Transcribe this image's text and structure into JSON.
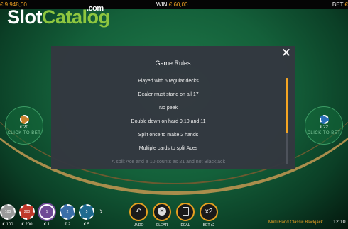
{
  "topbar": {
    "balance": "€ 9.948,00",
    "win_label": "WIN",
    "win_value": "€ 60,00",
    "bet_label": "BET",
    "bet_value": "€"
  },
  "logo": {
    "slot": "Slot",
    "catalog": "Catalog",
    "dotcom": ".com"
  },
  "bet_spots": [
    {
      "amount": "€ 20",
      "click_text": "CLICK TO BET",
      "chip_color": "#c9822c"
    },
    {
      "amount": "€ 22",
      "click_text": "CLICK TO BET",
      "chip_color": "#2a6fb8"
    }
  ],
  "modal": {
    "title": "Game Rules",
    "close_icon": "close-icon",
    "rules": [
      "Played with 6 regular decks",
      "Dealer must stand on all 17",
      "No peek",
      "Double down on hard 9,10 and 11",
      "Split once to make 2 hands",
      "Multiple cards to split Aces",
      "A split Ace and a 10 counts as 21 and not Blackjack"
    ],
    "scroll_fraction": 0.64
  },
  "chips": [
    {
      "value": "100",
      "label": "€ 100",
      "color": "#9a9a9a"
    },
    {
      "value": "200",
      "label": "€ 200",
      "color": "#c0392b"
    },
    {
      "value": "1",
      "label": "€ 1",
      "color": "#6f4a96",
      "selected": true
    },
    {
      "value": "2",
      "label": "€ 2",
      "color": "#3a6ea8"
    },
    {
      "value": "5",
      "label": "€ 5",
      "color": "#1f6a8f"
    }
  ],
  "controls": {
    "undo": {
      "label": "UNDO",
      "icon": "undo-icon"
    },
    "clear": {
      "label": "CLEAR",
      "icon": "clear-icon"
    },
    "deal": {
      "label": "DEAL",
      "icon": "deal-icon"
    },
    "bet_x2": {
      "label": "BET x2",
      "glyph": "x2"
    }
  },
  "game_name": "Multi Hand Classic Blackjack",
  "clock": "12:10",
  "colors": {
    "accent": "#f5a623",
    "felt": "#14603a",
    "modal_bg": "#343840",
    "logo_green": "#8ec63f"
  }
}
